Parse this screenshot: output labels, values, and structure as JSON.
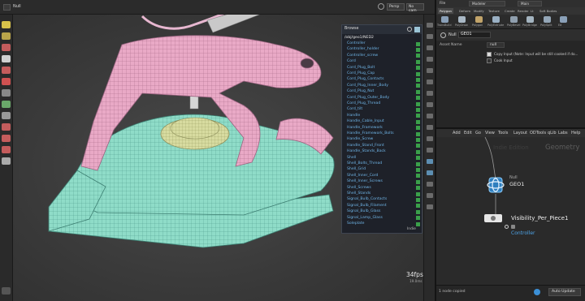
{
  "viewport": {
    "title": "Null",
    "path": "obj",
    "perspective": "Persp",
    "camera": "No cam",
    "fps": "34fps",
    "fps_sub": "19.0ms"
  },
  "tree": {
    "title": "Browse",
    "root": "/obj/geo1/NED2",
    "footer": "Indie",
    "items": [
      "Controller",
      "Controller_holder",
      "Controller_screw",
      "Cord",
      "Cord_Plug_Bolt",
      "Cord_Plug_Cap",
      "Cord_Plug_Contacts",
      "Cord_Plug_Inner_Body",
      "Cord_Plug_Nut",
      "Cord_Plug_Outer_Body",
      "Cord_Plug_Thread",
      "Cord_tilt",
      "Handle",
      "Handle_Cable_Input",
      "Handle_Framework",
      "Handle_Framework_Bolts",
      "Handle_Screw",
      "Handle_Stand_Front",
      "Handle_Stands_Back",
      "Shell",
      "Shell_Bolts_Thread",
      "Shell_Grid",
      "Shell_Inner_Cord",
      "Shell_Inner_Screws",
      "Shell_Screws",
      "Shell_Stands",
      "Signal_Bulb_Contacts",
      "Signal_Bulb_Filament",
      "Signal_Bulb_Glass",
      "Signal_Lamp_Glass",
      "Soleplate"
    ]
  },
  "right_panel": {
    "menu": [
      "File",
      "Modeler",
      "Main"
    ],
    "shelf_tabs": [
      "Polygon",
      "Deform",
      "Modify",
      "Texture",
      "Create",
      "Render",
      "Lt",
      "Soft Bodies"
    ],
    "shelf_tools": [
      "TransBuild",
      "PolyDraw",
      "Polygon",
      "PolyExtrude",
      "PolyBevel",
      "PolyBridge",
      "PolySplit",
      "Ed"
    ],
    "node_type": "Null",
    "node_name": "GEO1",
    "asset_name_label": "Asset Name",
    "asset_name_value": "null",
    "param_copy_input": "Copy Input (Note: Input will be still cooked if do...",
    "param_cook_input": "Cook Input",
    "net_menu": [
      "Add",
      "Edit",
      "Go",
      "View",
      "Tools",
      "Layout",
      "ODTools",
      "qLib",
      "Labs",
      "Help"
    ],
    "net_watermark": "Indie Edition",
    "net_context": "Geometry",
    "node1_type": "Null",
    "node1_name": "GEO1",
    "node2_name": "Visibility_Per_Piece1",
    "node2_sub": "Controller",
    "status_left": "1 node copied",
    "status_right": "Auto Update"
  }
}
